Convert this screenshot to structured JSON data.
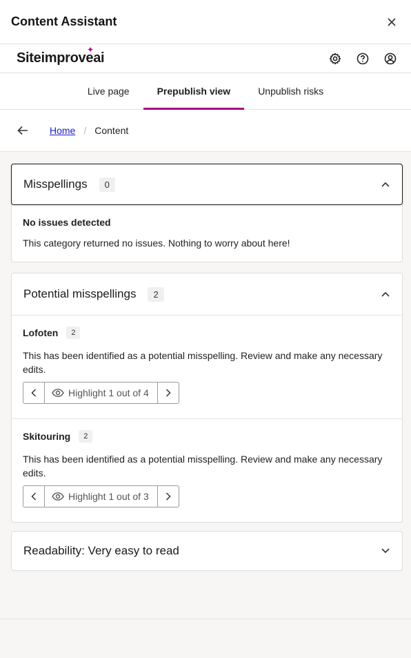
{
  "header": {
    "title": "Content Assistant"
  },
  "brand": {
    "name": "Siteimprove",
    "suffix": "ai",
    "accent": "#b5008f"
  },
  "icons": [
    "close-icon",
    "gear-icon",
    "help-icon",
    "user-icon",
    "arrow-left-icon",
    "chevron-up-icon",
    "chevron-down-icon",
    "chevron-left-icon",
    "chevron-right-icon",
    "eye-icon"
  ],
  "tabs": [
    {
      "label": "Live page"
    },
    {
      "label": "Prepublish view",
      "active": true
    },
    {
      "label": "Unpublish risks"
    }
  ],
  "breadcrumb": {
    "home": "Home",
    "separator": "/",
    "current": "Content"
  },
  "misspellings": {
    "title": "Misspellings",
    "count": "0",
    "empty_title": "No issues detected",
    "empty_text": "This category returned no issues. Nothing to worry about here!"
  },
  "potential": {
    "title": "Potential misspellings",
    "count": "2",
    "items": [
      {
        "word": "Lofoten",
        "count": "2",
        "text": "This has been identified as a potential misspelling. Review and make any necessary edits.",
        "highlight": "Highlight 1 out of 4"
      },
      {
        "word": "Skitouring",
        "count": "2",
        "text": "This has been identified as a potential misspelling. Review and make any necessary edits.",
        "highlight": "Highlight 1 out of 3"
      }
    ]
  },
  "readability": {
    "title": "Readability: Very easy to read"
  }
}
